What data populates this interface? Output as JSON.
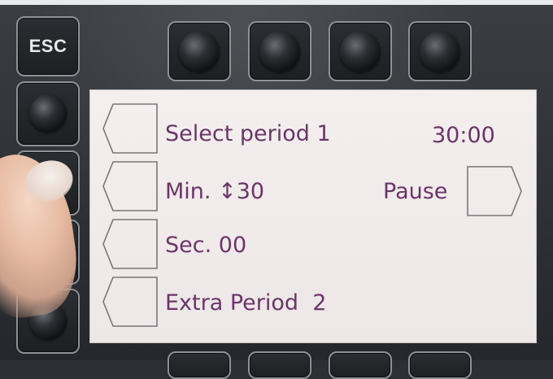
{
  "device": {
    "esc_label": "ESC"
  },
  "screen": {
    "rows": [
      {
        "left_label": "Select period 1",
        "right_value": "30:00"
      },
      {
        "left_label": "Min. ↕30",
        "right_label": "Pause"
      },
      {
        "left_label": "Sec. 00"
      },
      {
        "left_label": "Extra Period  2"
      }
    ]
  },
  "colors": {
    "lcd_text": "#6b3569",
    "lcd_background": "#f1ecec",
    "panel": "#2c2f33"
  }
}
